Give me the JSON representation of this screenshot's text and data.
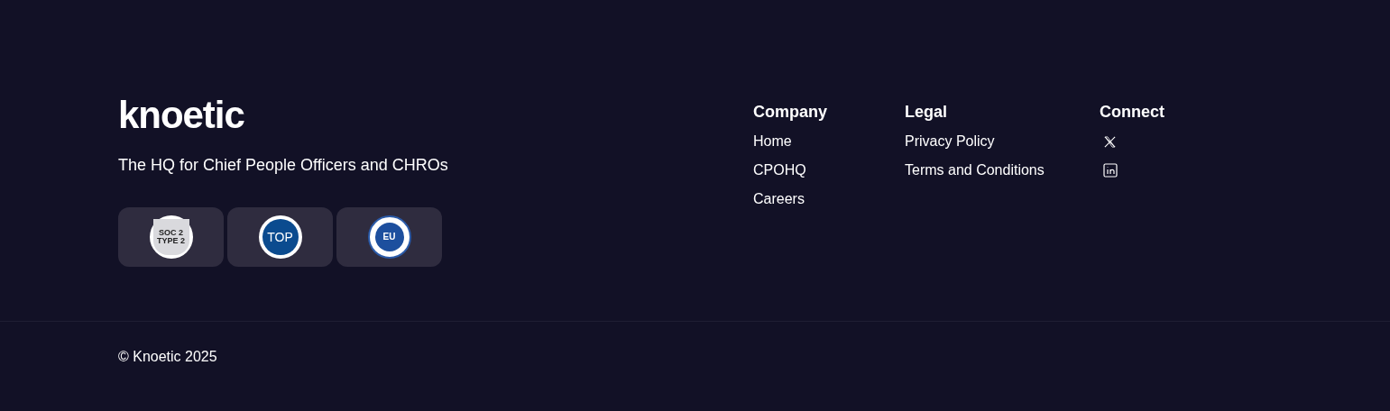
{
  "brand": {
    "logo": "knoetic",
    "tagline": "The HQ for Chief People Officers and CHROs"
  },
  "badges": [
    {
      "kind": "soc",
      "lines": [
        "SOC 2",
        "TYPE 2"
      ]
    },
    {
      "kind": "linkedin",
      "lines": [
        "TOP"
      ]
    },
    {
      "kind": "gdpr",
      "lines": [
        "EU"
      ]
    }
  ],
  "columns": [
    {
      "title": "Company",
      "links": [
        {
          "kind": "text",
          "label": "Home"
        },
        {
          "kind": "text",
          "label": "CPOHQ"
        },
        {
          "kind": "text",
          "label": "Careers"
        }
      ]
    },
    {
      "title": "Legal",
      "links": [
        {
          "kind": "text",
          "label": "Privacy Policy"
        },
        {
          "kind": "text",
          "label": "Terms and Conditions"
        }
      ]
    },
    {
      "title": "Connect",
      "links": [
        {
          "kind": "x"
        },
        {
          "kind": "linkedin"
        }
      ]
    }
  ],
  "copyright": "© Knoetic 2025"
}
